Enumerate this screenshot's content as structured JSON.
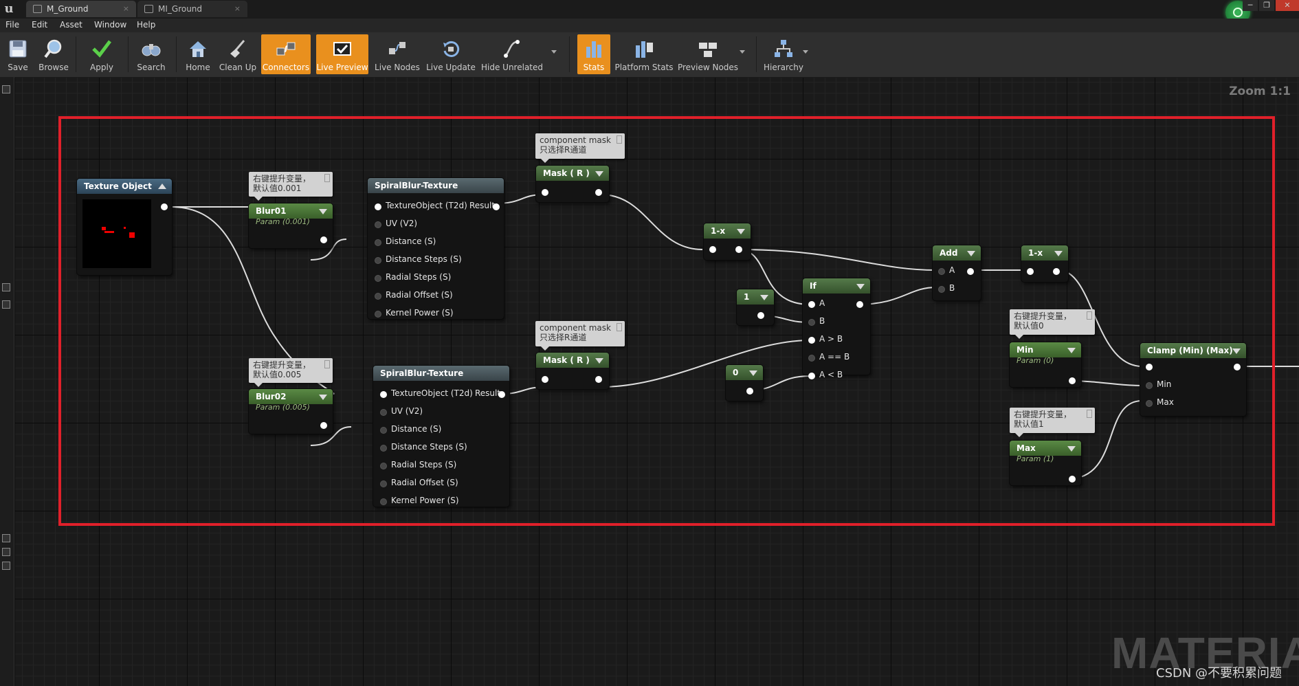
{
  "tabs": [
    {
      "label": "M_Ground",
      "close": "×"
    },
    {
      "label": "MI_Ground",
      "close": "×"
    }
  ],
  "window_buttons": [
    "─",
    "❐",
    "✕"
  ],
  "menu": [
    "File",
    "Edit",
    "Asset",
    "Window",
    "Help"
  ],
  "toolbar": [
    {
      "label": "Save",
      "icon": "save-icon"
    },
    {
      "label": "Browse",
      "icon": "magnifier-icon"
    },
    {
      "label": "Apply",
      "icon": "checkmark-icon"
    },
    {
      "label": "Search",
      "icon": "binoculars-icon"
    },
    {
      "label": "Home",
      "icon": "house-icon"
    },
    {
      "label": "Clean Up",
      "icon": "broom-icon"
    },
    {
      "label": "Connectors",
      "icon": "connectors-icon",
      "active": true
    },
    {
      "label": "Live Preview",
      "icon": "live-preview-icon",
      "active": true
    },
    {
      "label": "Live Nodes",
      "icon": "live-nodes-icon"
    },
    {
      "label": "Live Update",
      "icon": "live-update-icon"
    },
    {
      "label": "Hide Unrelated",
      "icon": "hide-unrelated-icon"
    },
    {
      "label": "Stats",
      "icon": "stats-icon",
      "active": true
    },
    {
      "label": "Platform Stats",
      "icon": "platform-stats-icon"
    },
    {
      "label": "Preview Nodes",
      "icon": "preview-nodes-icon"
    },
    {
      "label": "Hierarchy",
      "icon": "hierarchy-icon"
    }
  ],
  "graph": {
    "zoom": "Zoom 1:1",
    "watermark": "MATERIAL",
    "credit": "CSDN @不要积累问题"
  },
  "nodes": {
    "texture_object": {
      "title": "Texture Object"
    },
    "comment_blur01": {
      "line1": "右键提升变量，",
      "line2": "默认值0.001"
    },
    "blur01": {
      "title": "Blur01",
      "sub": "Param (0.001)"
    },
    "comment_blur02": {
      "line1": "右键提升变量，",
      "line2": "默认值0.005"
    },
    "blur02": {
      "title": "Blur02",
      "sub": "Param (0.005)"
    },
    "spiral1": {
      "title": "SpiralBlur-Texture",
      "result": "Result",
      "pins": [
        "TextureObject (T2d)",
        "UV (V2)",
        "Distance (S)",
        "Distance Steps (S)",
        "Radial Steps (S)",
        "Radial Offset (S)",
        "Kernel Power (S)"
      ]
    },
    "spiral2": {
      "title": "SpiralBlur-Texture",
      "result": "Result",
      "pins": [
        "TextureObject (T2d)",
        "UV (V2)",
        "Distance (S)",
        "Distance Steps (S)",
        "Radial Steps (S)",
        "Radial Offset (S)",
        "Kernel Power (S)"
      ]
    },
    "comment_mask1": {
      "line1": "component mask",
      "line2": "只选择R通道"
    },
    "mask1": {
      "title": "Mask ( R )"
    },
    "comment_mask2": {
      "line1": "component mask",
      "line2": "只选择R通道"
    },
    "mask2": {
      "title": "Mask ( R )"
    },
    "oneminus1": {
      "title": "1-x"
    },
    "const1": {
      "title": "1"
    },
    "const0": {
      "title": "0"
    },
    "if": {
      "title": "If",
      "pins": [
        "A",
        "B",
        "A > B",
        "A == B",
        "A < B"
      ]
    },
    "add": {
      "title": "Add",
      "pins": [
        "A",
        "B"
      ]
    },
    "oneminus2": {
      "title": "1-x"
    },
    "comment_min": {
      "line1": "右键提升变量，",
      "line2": "默认值0"
    },
    "min": {
      "title": "Min",
      "sub": "Param (0)"
    },
    "comment_max": {
      "line1": "右键提升变量，",
      "line2": "默认值1"
    },
    "max": {
      "title": "Max",
      "sub": "Param (1)"
    },
    "clamp": {
      "title": "Clamp (Min) (Max)",
      "pins": [
        "Min",
        "Max"
      ]
    }
  }
}
